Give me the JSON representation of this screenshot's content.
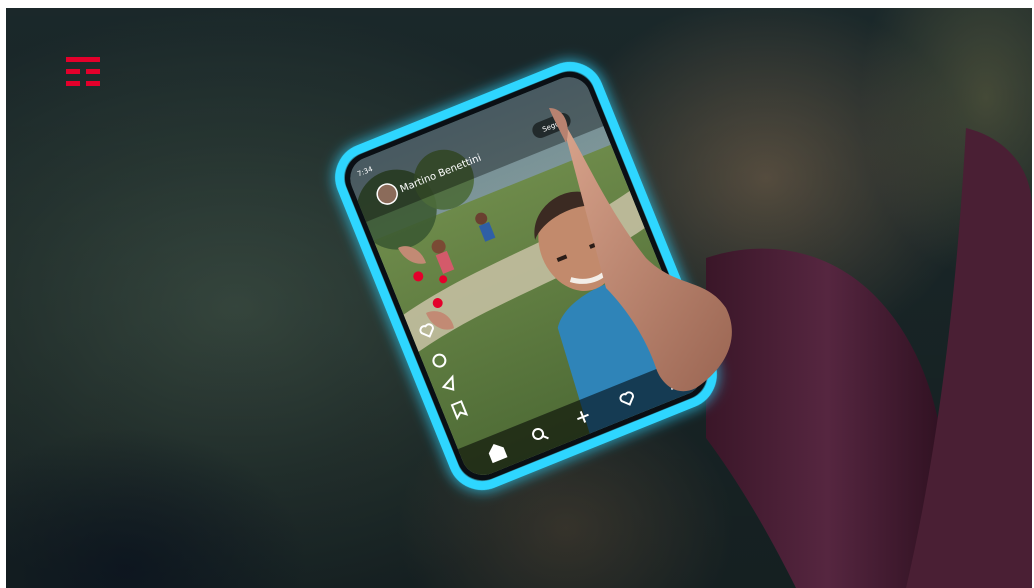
{
  "brand": {
    "logo_icon": "tim-logo-icon",
    "logo_color": "#e4002b"
  },
  "phone": {
    "frame_glow_color": "#2fd6ff",
    "status_time": "7:34",
    "post": {
      "username": "Martino Benettini",
      "follow_label": "Segui"
    },
    "side_actions": [
      "heart-icon",
      "comment-icon",
      "share-icon",
      "bookmark-icon"
    ],
    "bottom_nav": [
      "home-icon",
      "search-icon",
      "add-icon",
      "heart-icon",
      "profile-icon"
    ]
  },
  "colors": {
    "sleeve": "#4a1f34",
    "skin": "#c9907a",
    "shirt": "#2f84b8"
  }
}
